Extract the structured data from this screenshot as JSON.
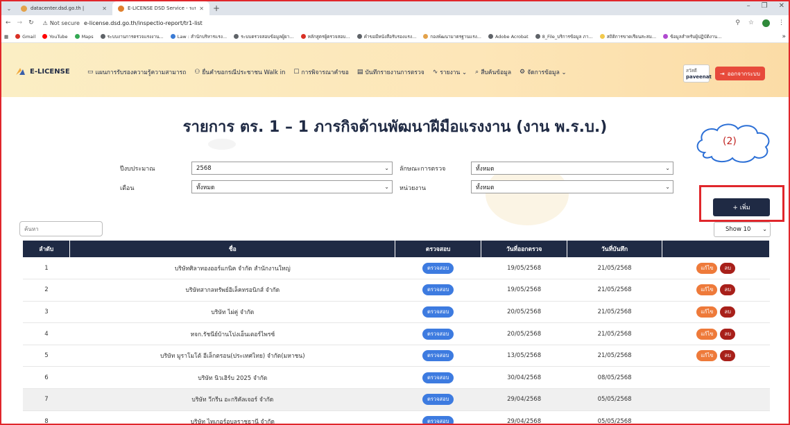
{
  "browser": {
    "tabs": [
      {
        "title": "datacenter.dsd.go.th |",
        "favicon_color": "#e3a24a",
        "active": false
      },
      {
        "title": "E-LICENSE DSD Service - ระบบใ",
        "favicon_color": "#e0802e",
        "active": true
      }
    ],
    "url": "e-license.dsd.go.th/inspectio-report/tr1-list",
    "not_secure_label": "Not secure",
    "bookmarks": [
      {
        "label": "Gmail",
        "color": "#d93025"
      },
      {
        "label": "YouTube",
        "color": "#ff0000"
      },
      {
        "label": "Maps",
        "color": "#34a853"
      },
      {
        "label": "ระบบงานการตรวจแรงงาน...",
        "color": "#5f6368"
      },
      {
        "label": "Law : สำนักบริหารแรง...",
        "color": "#3a7bd5"
      },
      {
        "label": "ระบบตรวจสอบข้อมูลผู้ยา...",
        "color": "#5f6368"
      },
      {
        "label": "หลักสูตรผู้ตรวจสอบ...",
        "color": "#d93025"
      },
      {
        "label": "คำขอมีหนังสือรับรองแรง...",
        "color": "#5f6368"
      },
      {
        "label": "กองพัฒนามาตรฐานแรง...",
        "color": "#e3a24a"
      },
      {
        "label": "Adobe Acrobat",
        "color": "#5f6368"
      },
      {
        "label": "8_File_บริการข้อมูล ภา...",
        "color": "#5f6368"
      },
      {
        "label": "สถิติการขาดเรียนสะสม...",
        "color": "#f2c94c"
      },
      {
        "label": "ข้อมูลสำหรับผู้ปฏิบัติงาน...",
        "color": "#b04ad0"
      }
    ]
  },
  "header": {
    "logo_text": "E-LICENSE",
    "nav": [
      {
        "icon": "book-icon",
        "glyph": "▭",
        "label": "แผนการรับรองความรู้ความสามารถ"
      },
      {
        "icon": "person-add-icon",
        "glyph": "⚇",
        "label": "ยื่นคำขอกรณีประชาชน Walk in"
      },
      {
        "icon": "clipboard-icon",
        "glyph": "☐",
        "label": "การพิจารณาคำขอ"
      },
      {
        "icon": "document-icon",
        "glyph": "▤",
        "label": "บันทึกรายงานการตรวจ"
      },
      {
        "icon": "chart-icon",
        "glyph": "∿",
        "label": "รายงาน ⌄"
      },
      {
        "icon": "search-icon",
        "glyph": "⌕",
        "label": "สืบค้นข้อมูล"
      },
      {
        "icon": "gear-icon",
        "glyph": "⚙",
        "label": "จัดการข้อมูล ⌄"
      }
    ],
    "user_greeting": "สวัสดี",
    "user_name": "paveenat",
    "logout_label": "ออกจากระบบ"
  },
  "page": {
    "title": "รายการ ตร. 1 – 1 ภารกิจด้านพัฒนาฝีมือแรงงาน (งาน พ.ร.บ.)",
    "annotation_label": "(2)"
  },
  "filters": {
    "fiscal_year_label": "ปีงบประมาณ",
    "fiscal_year_value": "2568",
    "month_label": "เดือน",
    "month_value": "ทั้งหมด",
    "inspection_type_label": "ลักษณะการตรวจ",
    "inspection_type_value": "ทั้งหมด",
    "agency_label": "หน่วยงาน",
    "agency_value": "ทั้งหมด"
  },
  "actions": {
    "add_label": "+ เพิ่ม",
    "search_placeholder": "ค้นหา",
    "show_label": "Show 10"
  },
  "table": {
    "headers": [
      "ลำดับ",
      "ชื่อ",
      "ตรวจสอบ",
      "วันที่ออกตรวจ",
      "วันที่บันทึก",
      ""
    ],
    "verify_label": "ตรวจสอบ",
    "edit_label": "แก้ไข",
    "delete_label": "ลบ",
    "rows": [
      {
        "no": "1",
        "name": "บริษัทศิลาทองออร์แกนิค จำกัด สำนักงานใหญ่",
        "inspect_date": "19/05/2568",
        "record_date": "21/05/2568",
        "has_actions": true
      },
      {
        "no": "2",
        "name": "บริษัทสากลทรัพย์อิเล็คทรอนิกส์ จำกัด",
        "inspect_date": "19/05/2568",
        "record_date": "21/05/2568",
        "has_actions": true
      },
      {
        "no": "3",
        "name": "บริษัท ไผ่คู่ จำกัด",
        "inspect_date": "20/05/2568",
        "record_date": "21/05/2568",
        "has_actions": true
      },
      {
        "no": "4",
        "name": "หจก.รัชนีย์บ้านโปงเอ็นเตอร์ไพรซ์",
        "inspect_date": "20/05/2568",
        "record_date": "21/05/2568",
        "has_actions": true
      },
      {
        "no": "5",
        "name": "บริษัท มูราโมโต้ อีเล็กตรอน(ประเทศไทย) จำกัด(มหาชน)",
        "inspect_date": "13/05/2568",
        "record_date": "21/05/2568",
        "has_actions": true
      },
      {
        "no": "6",
        "name": "บริษัท นิวเฮิร์บ 2025 จำกัด",
        "inspect_date": "30/04/2568",
        "record_date": "08/05/2568",
        "has_actions": false
      },
      {
        "no": "7",
        "name": "บริษัท วีกรีน อะกริคัลเจอร์ จำกัด",
        "inspect_date": "29/04/2568",
        "record_date": "05/05/2568",
        "has_actions": false
      },
      {
        "no": "8",
        "name": "บริษัท ไทเกอร์อุบลราชธานี จำกัด",
        "inspect_date": "29/04/2568",
        "record_date": "05/05/2568",
        "has_actions": false
      }
    ]
  },
  "colors": {
    "navy": "#1f2a44",
    "annotation_red": "#e0262b",
    "verify_blue": "#3d7be0",
    "edit_orange": "#ee7a3a",
    "delete_maroon": "#a8201a",
    "logout_red": "#e74a3b"
  }
}
